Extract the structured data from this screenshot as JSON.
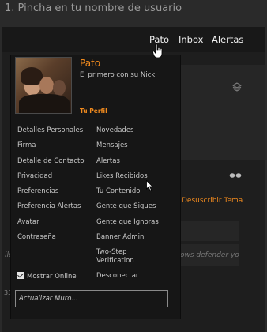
{
  "step_title": "1. Pincha en tu nombre de usuario",
  "nav": {
    "username": "Pato",
    "inbox": "Inbox",
    "alerts": "Alertas"
  },
  "background": {
    "unsubscribe": "Desuscribir Tema",
    "quote_left": "ile",
    "quote_right": "ows defender yo",
    "number": "35"
  },
  "profile": {
    "name": "Pato",
    "subtitle": "El primero con su Nick",
    "link": "Tu Perfil"
  },
  "menu_left": [
    "Detalles Personales",
    "Firma",
    "Detalle de Contacto",
    "Privacidad",
    "Preferencias",
    "Preferencia Alertas",
    "Avatar",
    "Contraseña"
  ],
  "menu_right": [
    "Novedades",
    "Mensajes",
    "Alertas",
    "Likes Recibidos",
    "Tu Contenido",
    "Gente que Sigues",
    "Gente que Ignoras",
    "Banner Admin",
    "Two-Step Verification"
  ],
  "show_online": "Mostrar Online",
  "disconnect": "Desconectar",
  "status_placeholder": "Actualizar Muro...",
  "colors": {
    "accent": "#f08a1e",
    "background": "#2a2a2a",
    "menu_bg": "#161616"
  }
}
